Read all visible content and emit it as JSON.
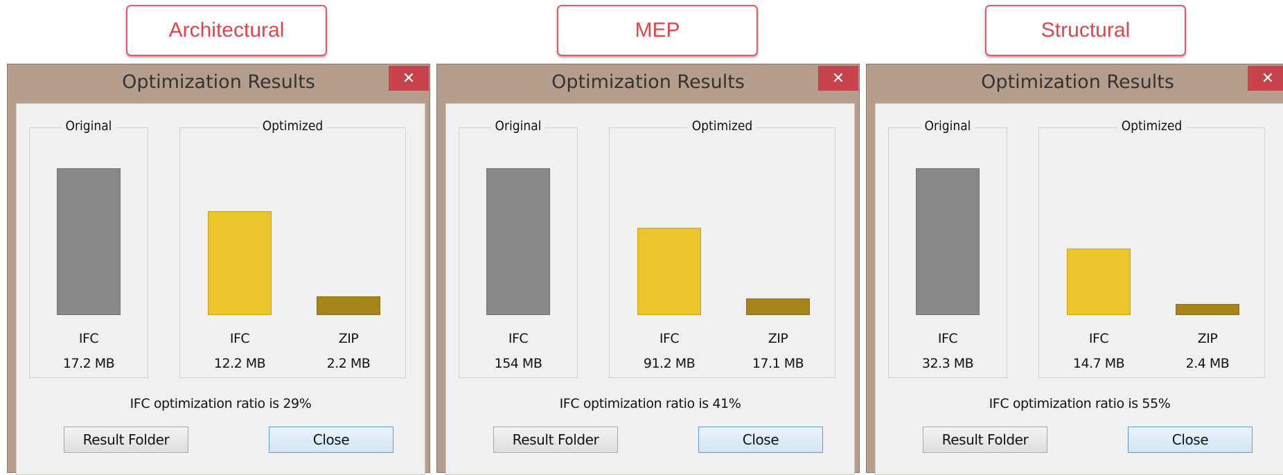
{
  "windows": [
    {
      "tag": "Architectural",
      "title": "Optimization Results",
      "close_glyph": "✕",
      "original_label": "Original",
      "optimized_label": "Optimized",
      "original_ifc": {
        "label": "IFC",
        "size": "17.2 MB",
        "size_mb": 17.2
      },
      "optimized_ifc": {
        "label": "IFC",
        "size": "12.2 MB",
        "size_mb": 12.2
      },
      "optimized_zip": {
        "label": "ZIP",
        "size": "2.2 MB",
        "size_mb": 2.2
      },
      "ratio_text": "IFC optimization ratio is 29%",
      "result_folder": "Result Folder",
      "close": "Close"
    },
    {
      "tag": "MEP",
      "title": "Optimization Results",
      "close_glyph": "✕",
      "original_label": "Original",
      "optimized_label": "Optimized",
      "original_ifc": {
        "label": "IFC",
        "size": "154 MB",
        "size_mb": 154
      },
      "optimized_ifc": {
        "label": "IFC",
        "size": "91.2 MB",
        "size_mb": 91.2
      },
      "optimized_zip": {
        "label": "ZIP",
        "size": "17.1 MB",
        "size_mb": 17.1
      },
      "ratio_text": "IFC optimization ratio is 41%",
      "result_folder": "Result Folder",
      "close": "Close"
    },
    {
      "tag": "Structural",
      "title": "Optimization Results",
      "close_glyph": "✕",
      "original_label": "Original",
      "optimized_label": "Optimized",
      "original_ifc": {
        "label": "IFC",
        "size": "32.3 MB",
        "size_mb": 32.3
      },
      "optimized_ifc": {
        "label": "IFC",
        "size": "14.7 MB",
        "size_mb": 14.7
      },
      "optimized_zip": {
        "label": "ZIP",
        "size": "2.4 MB",
        "size_mb": 2.4
      },
      "ratio_text": "IFC optimization ratio is 55%",
      "result_folder": "Result Folder",
      "close": "Close"
    }
  ],
  "colors": {
    "original_bar": "#888888",
    "optimized_ifc_bar": "#ecc52a",
    "optimized_zip_bar": "#a6861b",
    "tag_border": "#e35a62",
    "window_frame": "#b59e8c",
    "close_button": "#c7424a"
  }
}
